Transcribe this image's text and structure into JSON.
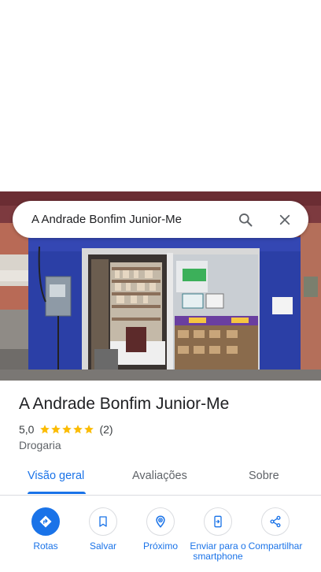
{
  "search": {
    "query": "A Andrade Bonfim Junior-Me"
  },
  "place": {
    "name": "A Andrade Bonfim Junior-Me",
    "rating": "5,0",
    "stars": 5,
    "review_count": "(2)",
    "category": "Drogaria"
  },
  "tabs": [
    {
      "label": "Visão geral",
      "active": true
    },
    {
      "label": "Avaliações",
      "active": false
    },
    {
      "label": "Sobre",
      "active": false
    }
  ],
  "actions": [
    {
      "label": "Rotas",
      "icon": "directions-icon"
    },
    {
      "label": "Salvar",
      "icon": "bookmark-icon"
    },
    {
      "label": "Próximo",
      "icon": "nearby-icon"
    },
    {
      "label": "Enviar para o smartphone",
      "icon": "send-to-phone-icon"
    },
    {
      "label": "Compartilhar",
      "icon": "share-icon"
    }
  ],
  "colors": {
    "accent": "#1a73e8",
    "star": "#fbbc04",
    "storefront": "#2a3fa8"
  }
}
